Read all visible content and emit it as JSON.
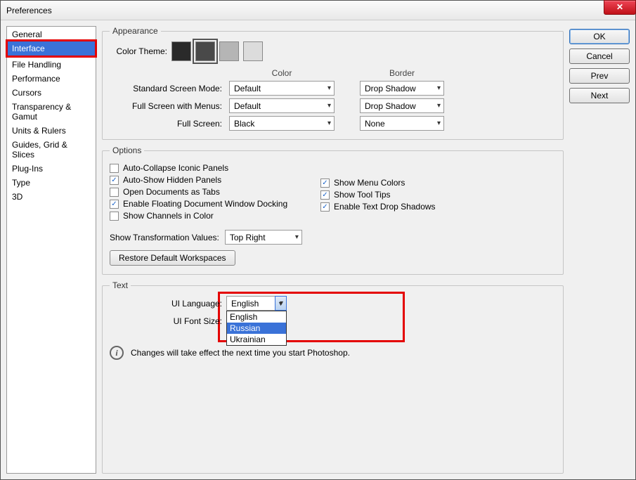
{
  "title": "Preferences",
  "sidebar": {
    "items": [
      {
        "label": "General"
      },
      {
        "label": "Interface"
      },
      {
        "label": "File Handling"
      },
      {
        "label": "Performance"
      },
      {
        "label": "Cursors"
      },
      {
        "label": "Transparency & Gamut"
      },
      {
        "label": "Units & Rulers"
      },
      {
        "label": "Guides, Grid & Slices"
      },
      {
        "label": "Plug-Ins"
      },
      {
        "label": "Type"
      },
      {
        "label": "3D"
      }
    ],
    "selected_index": 1
  },
  "buttons": {
    "ok": "OK",
    "cancel": "Cancel",
    "prev": "Prev",
    "next": "Next"
  },
  "appearance": {
    "legend": "Appearance",
    "color_theme_label": "Color Theme:",
    "swatches": [
      "#2a2a2a",
      "#494949",
      "#b5b5b5",
      "#dcdcdc"
    ],
    "selected_swatch": 1,
    "headers": {
      "color": "Color",
      "border": "Border"
    },
    "rows": [
      {
        "label": "Standard Screen Mode:",
        "color": "Default",
        "border": "Drop Shadow"
      },
      {
        "label": "Full Screen with Menus:",
        "color": "Default",
        "border": "Drop Shadow"
      },
      {
        "label": "Full Screen:",
        "color": "Black",
        "border": "None"
      }
    ]
  },
  "options": {
    "legend": "Options",
    "left": [
      {
        "label": "Auto-Collapse Iconic Panels",
        "checked": false
      },
      {
        "label": "Auto-Show Hidden Panels",
        "checked": true
      },
      {
        "label": "Open Documents as Tabs",
        "checked": false
      },
      {
        "label": "Enable Floating Document Window Docking",
        "checked": true
      },
      {
        "label": "Show Channels in Color",
        "checked": false
      }
    ],
    "right": [
      {
        "label": "Show Menu Colors",
        "checked": true
      },
      {
        "label": "Show Tool Tips",
        "checked": true
      },
      {
        "label": "Enable Text Drop Shadows",
        "checked": true
      }
    ],
    "show_tv_label": "Show Transformation Values:",
    "show_tv_value": "Top Right",
    "restore": "Restore Default Workspaces"
  },
  "text": {
    "legend": "Text",
    "lang_label": "UI Language:",
    "lang_value": "English",
    "lang_options": [
      "English",
      "Russian",
      "Ukrainian"
    ],
    "lang_highlight_index": 1,
    "size_label": "UI Font Size:",
    "info": "Changes will take effect the next time you start Photoshop."
  }
}
